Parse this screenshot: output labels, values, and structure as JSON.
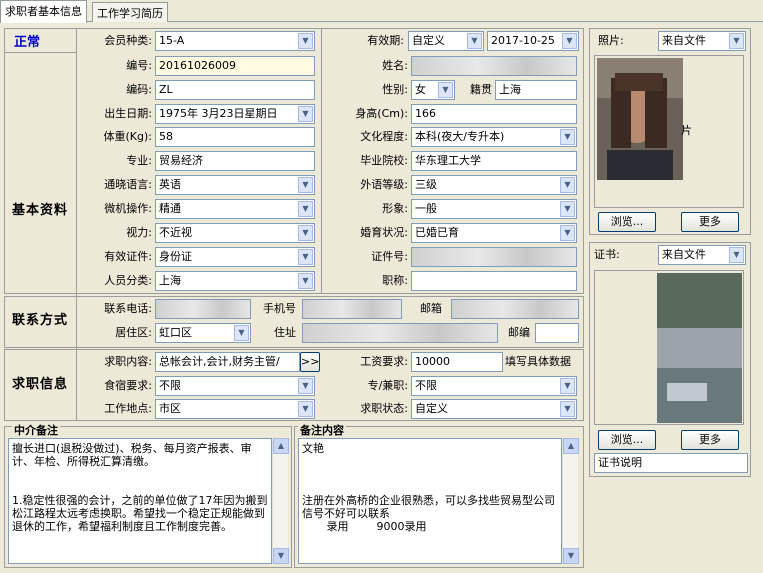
{
  "tabs": [
    {
      "label": "求职者基本信息"
    },
    {
      "label": "工作学习简历"
    }
  ],
  "status": {
    "label": "正常",
    "color": "#0000cc"
  },
  "groups": {
    "basic": "基本资料",
    "contact": "联系方式",
    "job": "求职信息"
  },
  "labels": {
    "member_type": "会员种类:",
    "valid_period": "有效期:",
    "number": "编号:",
    "name": "姓名:",
    "code": "编码:",
    "gender": "性别:",
    "native": "籍贯",
    "birth": "出生日期:",
    "height": "身高(Cm):",
    "weight": "体重(Kg):",
    "education": "文化程度:",
    "major": "专业:",
    "school": "毕业院校:",
    "language": "通晓语言:",
    "foreign_level": "外语等级:",
    "computer": "微机操作:",
    "image": "形象:",
    "vision": "视力:",
    "marriage": "婚育状况:",
    "id_doc": "有效证件:",
    "id_no": "证件号:",
    "person_type": "人员分类:",
    "title": "职称:",
    "phone": "联系电话:",
    "mobile": "手机号",
    "email": "邮箱",
    "district": "居住区:",
    "address": "住址",
    "zip": "邮编",
    "job_content": "求职内容:",
    "salary": "工资要求:",
    "salary_hint": "填写具体数据",
    "board": "食宿要求:",
    "full_part": "专/兼职:",
    "work_place": "工作地点:",
    "job_status": "求职状态:",
    "photo": "照片:",
    "cert": "证书:"
  },
  "values": {
    "member_type": "15-A",
    "valid_mode": "自定义",
    "valid_date": "2017-10-25",
    "number": "20161026009",
    "name": "",
    "code": "ZL",
    "gender": "女",
    "native": "上海",
    "birth": "1975年 3月23日星期日",
    "height": "166",
    "weight": "58",
    "education": "本科(夜大/专升本)",
    "major": "贸易经济",
    "school": "华东理工大学",
    "language": "英语",
    "foreign_level": "三级",
    "computer": "精通",
    "image": "一般",
    "vision": "不近视",
    "marriage": "已婚已育",
    "id_doc": "身份证",
    "id_no": "",
    "person_type": "上海",
    "title": "",
    "phone": "",
    "mobile": "",
    "email": "",
    "district": "虹口区",
    "address": "",
    "zip": "",
    "job_content": "总帐会计,会计,财务主管/",
    "salary": "10000",
    "board": "不限",
    "full_part": "不限",
    "work_place": "市区",
    "job_status": "自定义"
  },
  "photo": {
    "source": "来自文件",
    "caption": "片",
    "browse": "浏览...",
    "more": "更多"
  },
  "cert": {
    "source": "来自文件",
    "browse": "浏览...",
    "more": "更多",
    "desc": "证书说明"
  },
  "memo_agency": {
    "title": "中介备注",
    "text": "擅长进口(退税没做过)、税务、每月资产报表、审计、年检、所得税汇算清缴。\n\n\n1.稳定性很强的会计，之前的单位做了17年因为搬到松江路程太远考虑换职。希望找一个稳定正规能做到退休的工作，希望福利制度且工作制度完善。"
  },
  "memo_remark": {
    "title": "备注内容",
    "text": "文艳\n\n\n\n注册在外高桥的企业很熟悉，可以多找些贸易型公司 信号不好可以联系\n       录用        9000录用"
  },
  "more_btn": ">>"
}
